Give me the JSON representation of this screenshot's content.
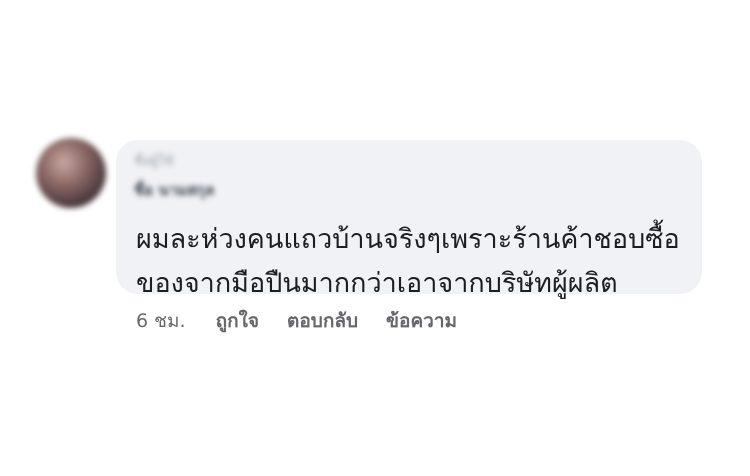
{
  "comment": {
    "author_line1": "ชื่อผู้ใช้",
    "author_line2": "ชื่อ นามสกุล",
    "text": "ผมละห่วงคนแถวบ้านจริงๆเพราะร้านค้าชอบซื้อของจากมือปืนมากกว่าเอาจากบริษัทผู้ผลิต"
  },
  "actions": {
    "time": "6 ชม.",
    "like": "ถูกใจ",
    "reply": "ตอบกลับ",
    "message": "ข้อความ"
  },
  "colors": {
    "bubble": "#f0f2f5",
    "text": "#1c1e21",
    "secondary": "#65676b"
  }
}
